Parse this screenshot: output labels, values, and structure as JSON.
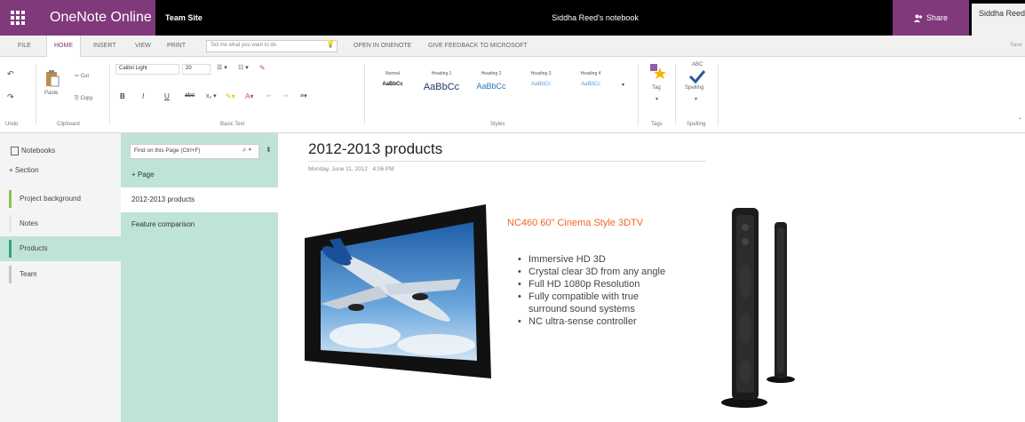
{
  "titlebar": {
    "app_name": "OneNote Online",
    "site": "Team Site",
    "notebook_title": "Siddha Reed's notebook",
    "share_label": "Share",
    "user_name": "Siddha Reed"
  },
  "menu": {
    "file": "FILE",
    "home": "HOME",
    "insert": "INSERT",
    "view": "VIEW",
    "print": "PRINT",
    "tell_me_placeholder": "Tell me what you want to do",
    "open_in_onenote": "OPEN IN ONENOTE",
    "give_feedback": "GIVE FEEDBACK TO MICROSOFT",
    "right_status": "Save"
  },
  "ribbon": {
    "undo_group": "Undo",
    "clipboard": {
      "paste": "Paste",
      "cut": "Cut",
      "copy": "Copy",
      "label": "Clipboard"
    },
    "basic_text": {
      "font": "Calibri Light",
      "size": "20",
      "label": "Basic Text"
    },
    "styles": {
      "items": [
        {
          "name": "Normal",
          "sample": "AaBbCc"
        },
        {
          "name": "Heading 1",
          "sample": "AaBbCc"
        },
        {
          "name": "Heading 2",
          "sample": "AaBbCc"
        },
        {
          "name": "Heading 3",
          "sample": "AaBbCc"
        },
        {
          "name": "Heading 4",
          "sample": "AaBbCc"
        }
      ],
      "label": "Styles"
    },
    "tag": {
      "button": "Tag",
      "label": "Tags"
    },
    "spelling": {
      "button": "Spelling",
      "label": "Spelling",
      "abc": "ABC"
    }
  },
  "sections": {
    "notebooks_label": "Notebooks",
    "add_section": "+ Section",
    "items": [
      {
        "label": "Project background",
        "color": "#8cc152"
      },
      {
        "label": "Notes",
        "color": "#f4f4f4"
      },
      {
        "label": "Products",
        "color": "#37a37f"
      },
      {
        "label": "Team",
        "color": "#c6c6c6"
      }
    ]
  },
  "pages": {
    "search_placeholder": "Find on this Page (Ctrl+F)",
    "add_page": "+ Page",
    "items": [
      "2012-2013 products",
      "Feature comparison"
    ]
  },
  "page": {
    "title": "2012-2013 products",
    "date": "Monday, June 11, 2012",
    "time": "4:06 PM",
    "product_title": "NC460 60\" Cinema Style 3DTV",
    "bullets": [
      "Immersive HD 3D",
      "Crystal clear 3D from any angle",
      "Full HD 1080p Resolution",
      "Fully compatible with true surround sound systems",
      "NC ultra-sense controller"
    ]
  },
  "colors": {
    "brand": "#80397b",
    "title_bar": "#000000",
    "page_panel": "#bfe3d8",
    "product_title": "#f26522"
  }
}
